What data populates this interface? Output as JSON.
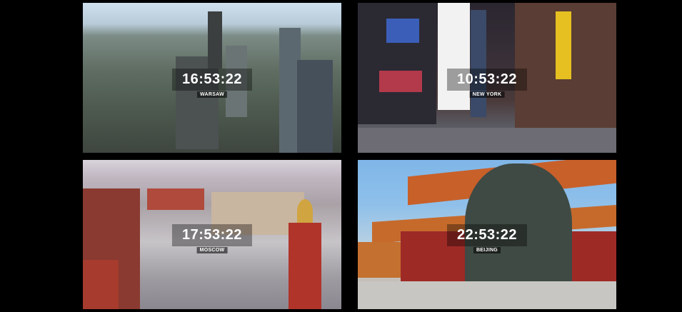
{
  "clocks": [
    {
      "time": "16:53:22",
      "city": "WARSAW"
    },
    {
      "time": "10:53:22",
      "city": "NEW YORK"
    },
    {
      "time": "17:53:22",
      "city": "MOSCOW"
    },
    {
      "time": "22:53:22",
      "city": "BEIJING"
    }
  ]
}
